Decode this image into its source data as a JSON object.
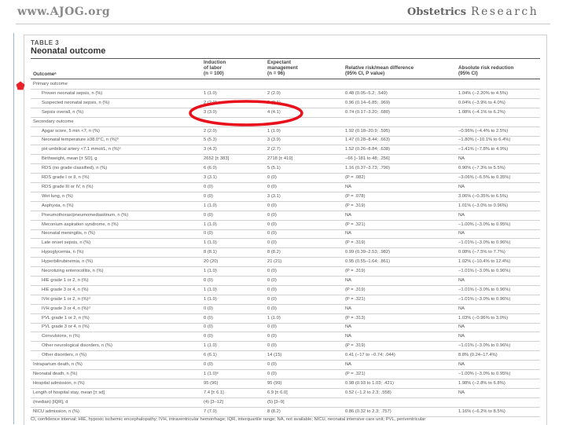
{
  "header": {
    "site": "www.AJOG.org",
    "journal_section": "Obstetrics",
    "journal_section_2": "Research"
  },
  "table": {
    "label": "TABLE 3",
    "title": "Neonatal outcome",
    "columns": {
      "outcome": "Outcomeᵃ",
      "induction_1": "Induction",
      "induction_2": "of labor",
      "induction_3": "(n = 100)",
      "expectant_1": "Expectant",
      "expectant_2": "management",
      "expectant_3": "(n = 96)",
      "rr_1": "Relative risk/mean difference",
      "rr_2": "(95% CI, P value)",
      "arr_1": "Absolute risk reduction",
      "arr_2": "(95% CI)"
    },
    "rows": [
      {
        "outcome": "Primary outcome",
        "ind": "",
        "exp": "",
        "rr": "",
        "arr": "",
        "indent": false
      },
      {
        "outcome": "Proven neonatal sepsis, n (%)",
        "ind": "1 (1.0)",
        "exp": "2 (2.0)",
        "rr": "0.48 (0.05–5.2; .549)",
        "arr": "1.04% (−2.20% to 4.5%)",
        "indent": true
      },
      {
        "outcome": "Suspected neonatal sepsis, n (%)",
        "ind": "2 (2.0)",
        "exp": "2 (2.1)",
        "rr": "0.96 (0.14–6.85; .969)",
        "arr": "0.04% (−3.9% to 4.0%)",
        "indent": true
      },
      {
        "outcome": "Sepsis overall, n (%)",
        "ind": "3 (3.0)",
        "exp": "4 (4.1)",
        "rr": "0.74 (0.17–3.20; .680)",
        "arr": "1.08% (−4.1% to 6.2%)",
        "indent": true
      },
      {
        "outcome": "Secondary outcome",
        "ind": "",
        "exp": "",
        "rr": "",
        "arr": "",
        "indent": false
      },
      {
        "outcome": "Apgar score, 5 min <7, n (%)",
        "ind": "2 (2.0)",
        "exp": "1 (1.0)",
        "rr": "1.92 (0.18–20.9; .595)",
        "arr": "−0.96% (−4.4% to 2.5%)",
        "indent": true
      },
      {
        "outcome": "Neonatal temperature ≥38.0°C, n (%)ᵇ",
        "ind": "5 (5.3)",
        "exp": "3 (3.9)",
        "rr": "1.47 (0.28–8.44; .663)",
        "arr": "−1.80% (−10.1% to 6.4%)",
        "indent": true
      },
      {
        "outcome": "pH umbilical artery <7.1 mmol/L, n (%)ᶜ",
        "ind": "3 (4.3)",
        "exp": "2 (2.7)",
        "rr": "1.52 (0.26–8.84; .638)",
        "arr": "−1.41% (−7.8% to 4.9%)",
        "indent": true
      },
      {
        "outcome": "Birthweight, mean [± SD], g",
        "ind": "2652 [± 383]",
        "exp": "2718 [± 419]",
        "rr": "−66 [−181 to 48; .256]",
        "arr": "NA",
        "indent": true
      },
      {
        "outcome": "RDS (no grade classified), n (%)",
        "ind": "6 (6.0)",
        "exp": "5 (5.1)",
        "rr": "1.16 (0.37–3.73; .790)",
        "arr": "0.90% (−7.3% to 5.5%)",
        "indent": true
      },
      {
        "outcome": "RDS grade I or II, n (%)",
        "ind": "3 (3.1)",
        "exp": "0 (0)",
        "rr": "(P = .082)",
        "arr": "−3.06% (−6.5% to 0.35%)",
        "indent": true
      },
      {
        "outcome": "RDS grade III or IV, n (%)",
        "ind": "0 (0)",
        "exp": "0 (0)",
        "rr": "NA",
        "arr": "NA",
        "indent": true
      },
      {
        "outcome": "Wet lung, n (%)",
        "ind": "0 (0)",
        "exp": "3 (3.1)",
        "rr": "(P = .078)",
        "arr": "3.06% (−0.35% to 6.5%)",
        "indent": true
      },
      {
        "outcome": "Asphyxia, n (%)",
        "ind": "1 (1.0)",
        "exp": "0 (0)",
        "rr": "(P = .319)",
        "arr": "1.01% (−3.0% to 0.96%)",
        "indent": true
      },
      {
        "outcome": "Pneumothorax/pneumomediastinum, n (%)",
        "ind": "0 (0)",
        "exp": "0 (0)",
        "rr": "NA",
        "arr": "NA",
        "indent": true
      },
      {
        "outcome": "Meconium aspiration syndrome, n (%)",
        "ind": "1 (1.0)",
        "exp": "0 (0)",
        "rr": "(P = .321)",
        "arr": "−1.00% (−3.0% to 0.95%)",
        "indent": true
      },
      {
        "outcome": "Neonatal meningitis, n (%)",
        "ind": "0 (0)",
        "exp": "0 (0)",
        "rr": "NA",
        "arr": "NA",
        "indent": true
      },
      {
        "outcome": "Late onset sepsis, n (%)",
        "ind": "1 (1.0)",
        "exp": "0 (0)",
        "rr": "(P = .319)",
        "arr": "−1.01% (−3.0% to 0.96%)",
        "indent": true
      },
      {
        "outcome": "Hypoglycemia, n (%)",
        "ind": "8 (8.1)",
        "exp": "8 (8.2)",
        "rr": "0.99 (0.39–2.53; .982)",
        "arr": "0.08% (−7.5% to 7.7%)",
        "indent": true
      },
      {
        "outcome": "Hyperbilirubinemia, n (%)",
        "ind": "20 (20)",
        "exp": "21 (21)",
        "rr": "0.95 (0.55–1.64; .861)",
        "arr": "1.02% (−10.4% to 12.4%)",
        "indent": true
      },
      {
        "outcome": "Necrotizing enterocolitis, n (%)",
        "ind": "1 (1.0)",
        "exp": "0 (0)",
        "rr": "(P = .319)",
        "arr": "−1.01% (−3.0% to 0.96%)",
        "indent": true
      },
      {
        "outcome": "HIE grade 1 or 2, n (%)",
        "ind": "0 (0)",
        "exp": "0 (0)",
        "rr": "NA",
        "arr": "NA",
        "indent": true
      },
      {
        "outcome": "HIE grade 3 or 4, n (%)",
        "ind": "1 (1.0)",
        "exp": "0 (0)",
        "rr": "(P = .319)",
        "arr": "−1.01% (−3.0% to 0.96%)",
        "indent": true
      },
      {
        "outcome": "IVH grade 1 or 2, n (%)ᵈ",
        "ind": "1 (1.0)",
        "exp": "0 (0)",
        "rr": "(P = .321)",
        "arr": "−1.01% (−3.0% to 0.96%)",
        "indent": true
      },
      {
        "outcome": "IVH grade 3 or 4, n (%)ᵈ",
        "ind": "0 (0)",
        "exp": "0 (0)",
        "rr": "NA",
        "arr": "NA",
        "indent": true
      },
      {
        "outcome": "PVL grade 1 or 2, n (%)",
        "ind": "0 (0)",
        "exp": "1 (1.0)",
        "rr": "(P = .313)",
        "arr": "1.03% (−0.96% to 3.0%)",
        "indent": true
      },
      {
        "outcome": "PVL grade 3 or 4, n (%)",
        "ind": "0 (0)",
        "exp": "0 (0)",
        "rr": "NA",
        "arr": "NA",
        "indent": true
      },
      {
        "outcome": "Convulsions, n (%)",
        "ind": "0 (0)",
        "exp": "0 (0)",
        "rr": "NA",
        "arr": "NA",
        "indent": true
      },
      {
        "outcome": "Other neurological disorders, n (%)",
        "ind": "1 (1.0)",
        "exp": "0 (0)",
        "rr": "(P = .319)",
        "arr": "−1.01% (−3.0% to 0.96%)",
        "indent": true
      },
      {
        "outcome": "Other disorders, n (%)",
        "ind": "6 (6.1)",
        "exp": "14 (15)",
        "rr": "0.41 (−17 to −0.74; .044)",
        "arr": "8.8% (0.24–17.4%)",
        "indent": true
      },
      {
        "outcome": "Intrapartum death, n (%)",
        "ind": "0 (0)",
        "exp": "0 (0)",
        "rr": "NA",
        "arr": "NA",
        "indent": false
      },
      {
        "outcome": "Neonatal death, n (%)",
        "ind": "1 (1.0)ᵉ",
        "exp": "0 (0)",
        "rr": "(P = .321)",
        "arr": "−1.00% (−3.0% to 0.95%)",
        "indent": false
      },
      {
        "outcome": "Hospital admission, n (%)",
        "ind": "95 (96)",
        "exp": "95 (99)",
        "rr": "0.98 (0.93 to 1.03; .421)",
        "arr": "1.98% (−2.8% to 6.8%)",
        "indent": false
      },
      {
        "outcome": "Length of hospital stay, mean [± sd]",
        "ind": "7.4 [± 6.1]",
        "exp": "6.9 [± 6.0]",
        "rr": "0.52 (−1.2 to 2.3; .558)",
        "arr": "NA",
        "indent": false
      },
      {
        "outcome": "(median) [IQR], d",
        "ind": "(4) [3–12]",
        "exp": "(5) [3–9]",
        "rr": "",
        "arr": "",
        "indent": false
      },
      {
        "outcome": "NICU admission, n (%)",
        "ind": "7 (7.0)",
        "exp": "8 (8.2)",
        "rr": "0.86 (0.32 to 2.3; .757)",
        "arr": "1.16% (−6.2% to 8.5%)",
        "indent": false
      }
    ],
    "footnote": "CI, confidence interval; HIE, hypoxic ischemic encephalopathy; IVH, intraventricular hemorrhage; IQR, interquartile range; NA, not available; NICU, neonatal intensive care unit; PVL, periventricular"
  },
  "annotations": {
    "marker_color": "#e8212b",
    "ellipse_color": "#e8111b"
  }
}
